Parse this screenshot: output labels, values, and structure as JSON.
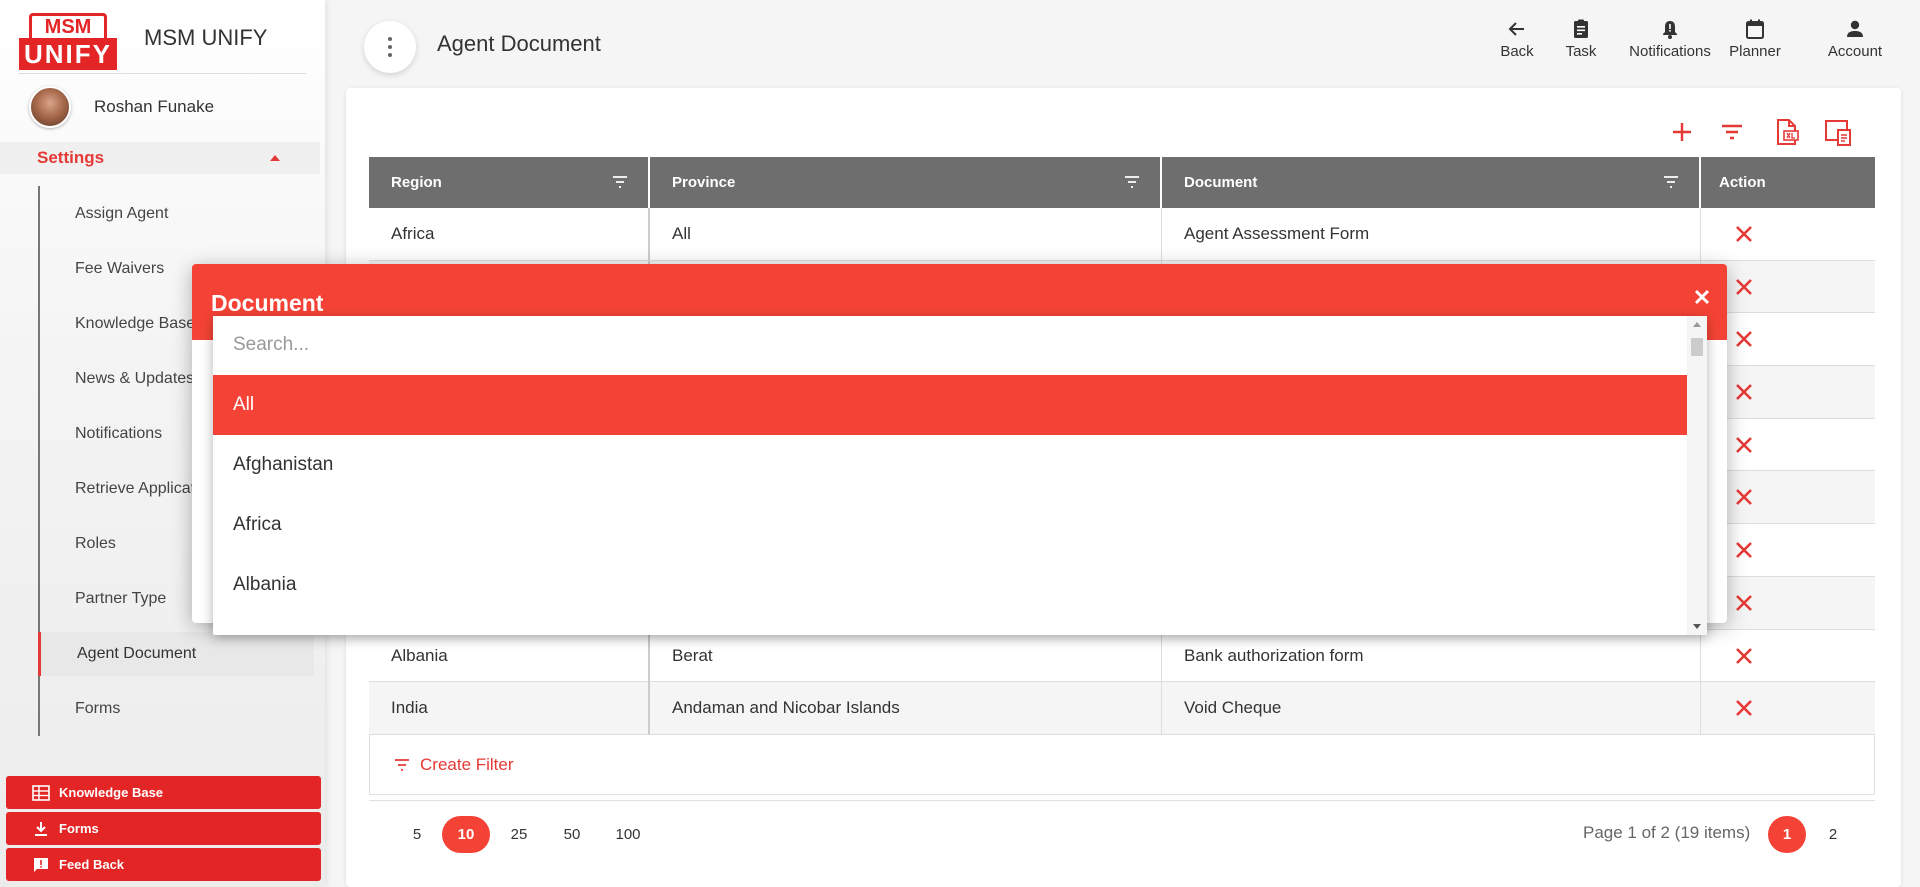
{
  "app": {
    "logo_top": "MSM",
    "logo_bottom": "UNIFY",
    "name": "MSM UNIFY"
  },
  "user": {
    "name": "Roshan Funake"
  },
  "sidebar": {
    "section": "Settings",
    "items": [
      {
        "label": "Assign Agent"
      },
      {
        "label": "Fee Waivers"
      },
      {
        "label": "Knowledge Base"
      },
      {
        "label": "News & Updates"
      },
      {
        "label": "Notifications"
      },
      {
        "label": "Retrieve Applications"
      },
      {
        "label": "Roles"
      },
      {
        "label": "Partner Type"
      },
      {
        "label": "Agent Document"
      },
      {
        "label": "Forms"
      }
    ],
    "bottom_buttons": [
      {
        "label": "Knowledge Base",
        "icon": "table-icon"
      },
      {
        "label": "Forms",
        "icon": "download-icon"
      },
      {
        "label": "Feed Back",
        "icon": "feedback-icon"
      }
    ]
  },
  "header": {
    "title": "Agent Document",
    "buttons": [
      {
        "label": "Back",
        "icon": "arrow-left-icon"
      },
      {
        "label": "Task",
        "icon": "clipboard-icon"
      },
      {
        "label": "Notifications",
        "icon": "bell-icon"
      },
      {
        "label": "Planner",
        "icon": "calendar-icon"
      },
      {
        "label": "Account",
        "icon": "person-icon"
      }
    ]
  },
  "toolbar": {
    "icons": [
      "add-icon",
      "filter-icon",
      "export-excel-icon",
      "export-pdf-icon"
    ]
  },
  "grid": {
    "columns": [
      "Region",
      "Province",
      "Document",
      "Action"
    ],
    "rows": [
      {
        "region": "Africa",
        "province": "All",
        "document": "Agent Assessment Form"
      },
      {
        "region": "",
        "province": "",
        "document": ""
      },
      {
        "region": "",
        "province": "",
        "document": ""
      },
      {
        "region": "",
        "province": "",
        "document": ""
      },
      {
        "region": "",
        "province": "",
        "document": ""
      },
      {
        "region": "",
        "province": "",
        "document": ""
      },
      {
        "region": "",
        "province": "",
        "document": ""
      },
      {
        "region": "",
        "province": "",
        "document": ""
      },
      {
        "region": "Albania",
        "province": "Berat",
        "document": "Bank authorization form"
      },
      {
        "region": "India",
        "province": "Andaman and Nicobar Islands",
        "document": "Void Cheque"
      }
    ],
    "create_filter": "Create Filter"
  },
  "pager": {
    "sizes": [
      "5",
      "10",
      "25",
      "50",
      "100"
    ],
    "selected_size": "10",
    "info": "Page 1 of 2 (19 items)",
    "pages": [
      "1",
      "2"
    ],
    "current_page": "1"
  },
  "dialog": {
    "title": "Document",
    "search_placeholder": "Search...",
    "options": [
      "All",
      "Afghanistan",
      "Africa",
      "Albania"
    ],
    "selected_option": "All"
  },
  "colors": {
    "accent": "#f44336",
    "brand": "#e42525",
    "header_gray": "#6e6e6e"
  }
}
